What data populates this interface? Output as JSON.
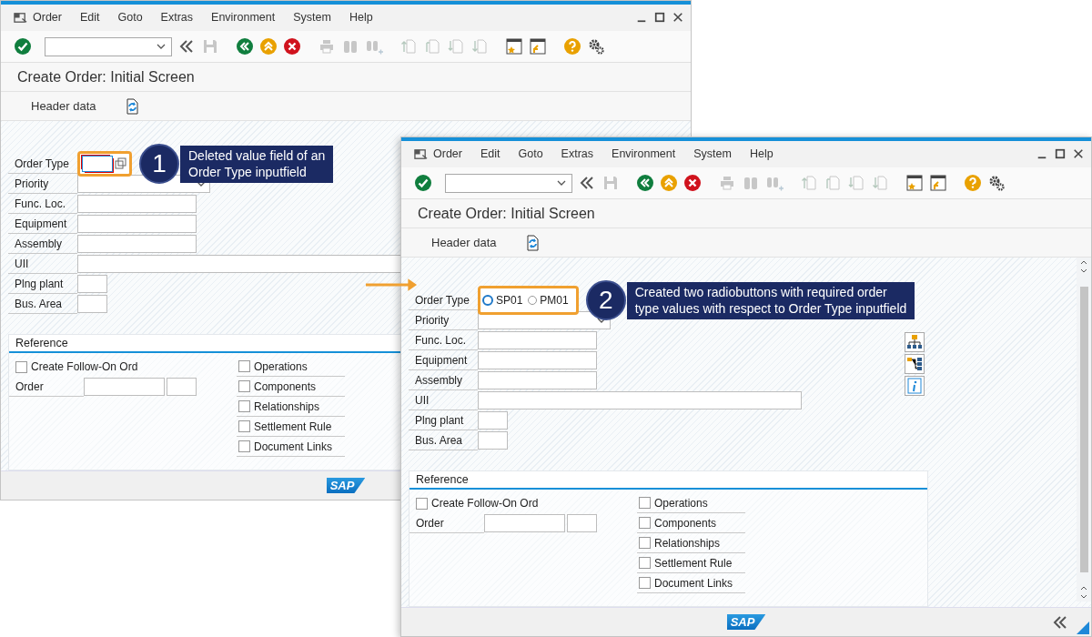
{
  "windows": [
    {
      "active": false,
      "menu": [
        "Order",
        "Edit",
        "Goto",
        "Extras",
        "Environment",
        "System",
        "Help"
      ],
      "toolbar": [
        {
          "disabled": false
        },
        {
          "disabled": false
        },
        {
          "disabled": true
        },
        {
          "disabled": false
        },
        {
          "disabled": false
        },
        {
          "disabled": false
        },
        {
          "disabled": true
        },
        {
          "disabled": true
        },
        {
          "disabled": true
        },
        {
          "disabled": true
        },
        {
          "disabled": true
        },
        {
          "disabled": true
        },
        {
          "disabled": true
        },
        {
          "disabled": false
        },
        {
          "disabled": false
        },
        {
          "disabled": false
        },
        {
          "disabled": false
        }
      ],
      "title": "Create Order: Initial Screen",
      "app_toolbar": {
        "label": "Header data"
      },
      "order_type": {
        "label": "Order Type",
        "kind": "input"
      },
      "callout": {
        "number": "1",
        "lines": [
          "Deleted value field of an",
          "Order Type inputfield"
        ]
      },
      "fields": [
        {
          "label": "Priority",
          "kind": "dropdown"
        },
        {
          "label": "Func. Loc.",
          "kind": "input"
        },
        {
          "label": "Equipment",
          "kind": "input"
        },
        {
          "label": "Assembly",
          "kind": "input"
        },
        {
          "label": "UII",
          "kind": "input"
        },
        {
          "label": "Plng plant",
          "kind": "input"
        },
        {
          "label": "Bus. Area",
          "kind": "input"
        }
      ],
      "reference": {
        "title": "Reference",
        "follow_on": {
          "label": "Create Follow-On Ord",
          "checked": false
        },
        "order_label": "Order",
        "options": [
          {
            "label": "Operations",
            "checked": false
          },
          {
            "label": "Components",
            "checked": false
          },
          {
            "label": "Relationships",
            "checked": false
          },
          {
            "label": "Settlement Rule",
            "checked": false
          },
          {
            "label": "Document Links",
            "checked": false
          }
        ]
      },
      "logo": "SAP"
    },
    {
      "active": true,
      "menu": [
        "Order",
        "Edit",
        "Goto",
        "Extras",
        "Environment",
        "System",
        "Help"
      ],
      "toolbar": [
        {
          "disabled": false
        },
        {
          "disabled": false
        },
        {
          "disabled": true
        },
        {
          "disabled": false
        },
        {
          "disabled": false
        },
        {
          "disabled": false
        },
        {
          "disabled": true
        },
        {
          "disabled": true
        },
        {
          "disabled": true
        },
        {
          "disabled": true
        },
        {
          "disabled": true
        },
        {
          "disabled": true
        },
        {
          "disabled": true
        },
        {
          "disabled": false
        },
        {
          "disabled": false
        },
        {
          "disabled": false
        },
        {
          "disabled": false
        }
      ],
      "title": "Create Order: Initial Screen",
      "app_toolbar": {
        "label": "Header data"
      },
      "order_type": {
        "label": "Order Type",
        "kind": "radio",
        "options": [
          {
            "label": "SP01",
            "selected": false,
            "focused": true
          },
          {
            "label": "PM01",
            "selected": false,
            "focused": false
          }
        ]
      },
      "callout": {
        "number": "2",
        "lines": [
          "Created two radiobuttons with required order",
          "type values with respect to Order Type inputfield"
        ]
      },
      "fields": [
        {
          "label": "Priority",
          "kind": "dropdown"
        },
        {
          "label": "Func. Loc.",
          "kind": "input"
        },
        {
          "label": "Equipment",
          "kind": "input"
        },
        {
          "label": "Assembly",
          "kind": "input"
        },
        {
          "label": "UII",
          "kind": "input"
        },
        {
          "label": "Plng plant",
          "kind": "input"
        },
        {
          "label": "Bus. Area",
          "kind": "input"
        }
      ],
      "reference": {
        "title": "Reference",
        "follow_on": {
          "label": "Create Follow-On Ord",
          "checked": false
        },
        "order_label": "Order",
        "options": [
          {
            "label": "Operations",
            "checked": false
          },
          {
            "label": "Components",
            "checked": false
          },
          {
            "label": "Relationships",
            "checked": false
          },
          {
            "label": "Settlement Rule",
            "checked": false
          },
          {
            "label": "Document Links",
            "checked": false
          }
        ]
      },
      "logo": "SAP"
    }
  ]
}
